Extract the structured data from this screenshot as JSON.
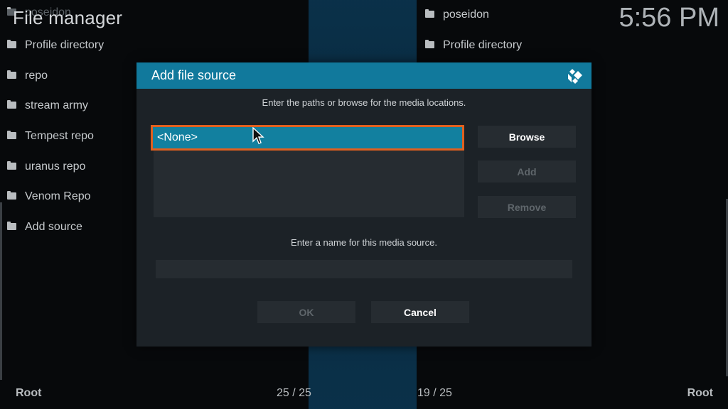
{
  "header": {
    "title": "File manager",
    "clock": "5:56 PM"
  },
  "left_pane": {
    "ghost_item": "poseidon",
    "items": [
      {
        "label": "Profile directory"
      },
      {
        "label": "repo"
      },
      {
        "label": "stream army"
      },
      {
        "label": "Tempest repo"
      },
      {
        "label": "uranus repo"
      },
      {
        "label": "Venom Repo"
      },
      {
        "label": "Add source"
      }
    ],
    "footer_root": "Root",
    "footer_count": "25 / 25"
  },
  "right_pane": {
    "items": [
      {
        "label": "poseidon"
      },
      {
        "label": "Profile directory"
      }
    ],
    "footer_count": "19 / 25",
    "footer_root": "Root"
  },
  "dialog": {
    "title": "Add file source",
    "paths_hint": "Enter the paths or browse for the media locations.",
    "path_entry": "<None>",
    "buttons": {
      "browse": "Browse",
      "add": "Add",
      "remove": "Remove",
      "ok": "OK",
      "cancel": "Cancel"
    },
    "name_hint": "Enter a name for this media source.",
    "name_value": ""
  },
  "colors": {
    "header_blue": "#11799c",
    "selection_blue": "#12809f",
    "focus_orange": "#e0601f",
    "dialog_bg": "#1c2227"
  },
  "icons": [
    "folder-icon",
    "kodi-logo-icon",
    "mouse-pointer-icon"
  ]
}
